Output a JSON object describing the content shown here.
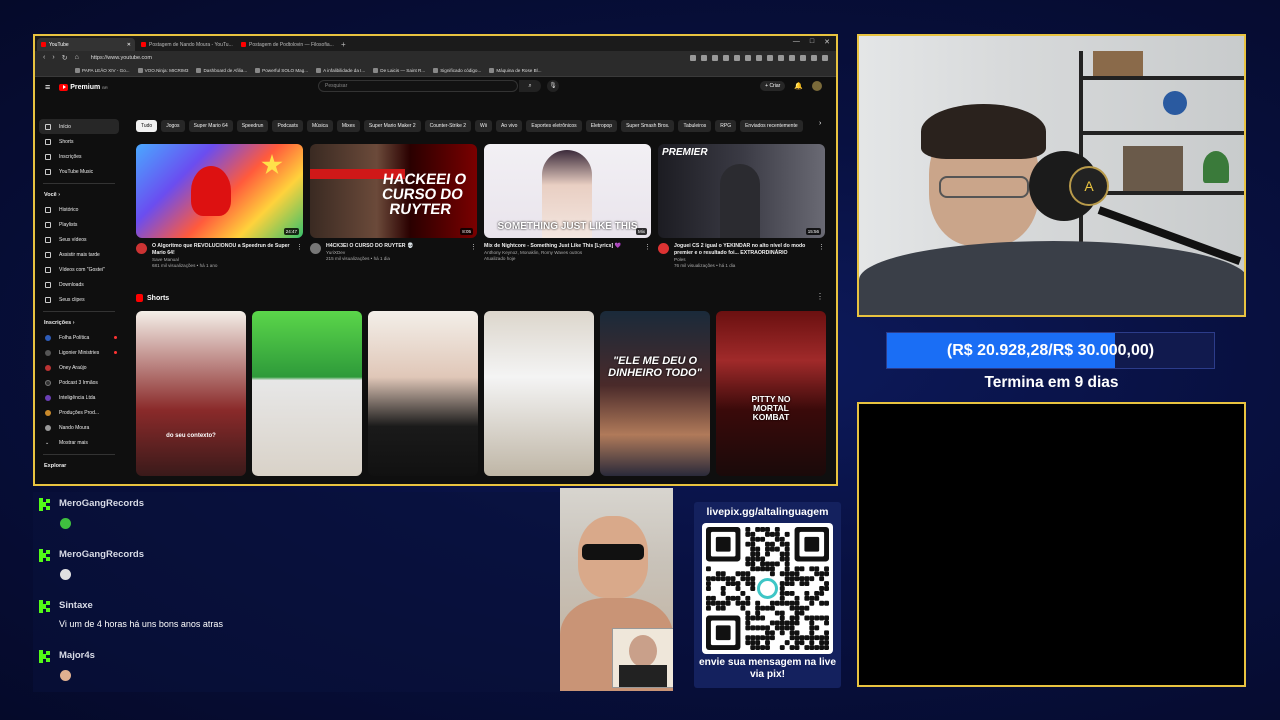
{
  "browser": {
    "tabs": [
      {
        "label": "YouTube",
        "active": true
      },
      {
        "label": "Postagem de Nando Moura - YouTu...",
        "active": false
      },
      {
        "label": "Postagem de Podtolovin — Filosofia...",
        "active": false
      }
    ],
    "new_tab": "+",
    "window_controls": [
      "—",
      "□",
      "✕"
    ],
    "url": "https://www.youtube.com",
    "bookmarks": [
      "PAPA LEÃO XIV - Go...",
      "VOO.Ninja: MICRIM3",
      "Dashboard de Afilia...",
      "Powerful SOLO Mag...",
      "A infalibilidade da I...",
      "De Laicis — Saint R...",
      "Significado código...",
      "Máquina de Rose Bl..."
    ]
  },
  "youtube": {
    "logo": "Premium",
    "logo_sup": "BR",
    "search_placeholder": "Pesquisar",
    "create_label": "Criar",
    "sidebar": {
      "main": [
        {
          "label": "Início",
          "icon": "home-icon",
          "active": true
        },
        {
          "label": "Shorts",
          "icon": "shorts-icon"
        },
        {
          "label": "Inscrições",
          "icon": "subscriptions-icon"
        },
        {
          "label": "YouTube Music",
          "icon": "music-icon"
        }
      ],
      "voce_title": "Você",
      "voce": [
        {
          "label": "Histórico",
          "icon": "history-icon"
        },
        {
          "label": "Playlists",
          "icon": "playlist-icon"
        },
        {
          "label": "Seus vídeos",
          "icon": "your-videos-icon"
        },
        {
          "label": "Assistir mais tarde",
          "icon": "watch-later-icon"
        },
        {
          "label": "Vídeos com \"Gostei\"",
          "icon": "like-icon"
        },
        {
          "label": "Downloads",
          "icon": "download-icon"
        },
        {
          "label": "Seus clipes",
          "icon": "clips-icon"
        }
      ],
      "subs_title": "Inscrições",
      "subs": [
        {
          "label": "Folha Política",
          "color": "#2e5cb8"
        },
        {
          "label": "Ligonier Ministries",
          "color": "#555555"
        },
        {
          "label": "Oney Araújo",
          "color": "#b33"
        },
        {
          "label": "Podcast 3 Irmãos",
          "color": "#333"
        },
        {
          "label": "Inteligência Ltda",
          "color": "#6a3fb5"
        },
        {
          "label": "Produções Prod...",
          "color": "#c98a2b"
        },
        {
          "label": "Nando Moura",
          "color": "#999"
        }
      ],
      "show_more": "Mostrar mais",
      "explore": "Explorar"
    },
    "chips": [
      "Tudo",
      "Jogos",
      "Super Mario 64",
      "Speedrun",
      "Podcasts",
      "Música",
      "Mixes",
      "Super Mario Maker 2",
      "Counter-Strike 2",
      "Wii",
      "Ao vivo",
      "Esportes eletrônicos",
      "Eletropop",
      "Super Smash Bros.",
      "Tabuleiros",
      "RPG",
      "Enviados recentemente"
    ],
    "videos": [
      {
        "title": "O Algoritmo que REVOLUCIONOU a Speedrun de Super Mario 64!",
        "channel": "Save Manual",
        "meta": "681 mil visualizações • há 1 ano",
        "duration": "24:47",
        "thumb_text": ""
      },
      {
        "title": "H4CK3EI O CURSO DO RUYTER 💀",
        "channel": "YuriXDev",
        "meta": "215 mil visualizações • há 1 dia",
        "duration": "8:05",
        "thumb_text": "HACKEEI O CURSO DO RUYTER"
      },
      {
        "title": "Mix de Nightcore - Something Just Like This [Lyrics] 💜",
        "channel": "Anthony Keynoz, Monaklin, Romy Waves outros",
        "meta": "Atualizado hoje",
        "duration": "Mix",
        "thumb_text": "SOMETHING JUST LIKE THIS"
      },
      {
        "title": "Joguei CS 2 igual o YEKINDAR no alto nível do modo premier e o resultado foi... EXTRAORDINÁRIO",
        "channel": "Poles",
        "meta": "76 mil visualizações • há 1 dia",
        "duration": "15:56",
        "thumb_text": "PREMIER"
      }
    ],
    "shorts_title": "Shorts",
    "shorts": [
      {
        "caption": "do seu contexto?"
      },
      {
        "caption": ""
      },
      {
        "caption": ""
      },
      {
        "caption": ""
      },
      {
        "caption": "\"ELE ME DEU O DINHEIRO TODO\""
      },
      {
        "caption": "PITTY NO MORTAL KOMBAT"
      }
    ]
  },
  "chat": [
    {
      "user": "MeroGangRecords",
      "text": "",
      "emote_color": "#3fbf3f"
    },
    {
      "user": "MeroGangRecords",
      "text": "",
      "emote_color": "#e0e0e0"
    },
    {
      "user": "Sintaxe",
      "text": "Vi um de 4 horas há uns bons anos atras",
      "emote_color": ""
    },
    {
      "user": "Major4s",
      "text": "",
      "emote_color": "#e0b090"
    }
  ],
  "qr": {
    "url": "livepix.gg/altalinguagem",
    "caption": "envie sua mensagem na live via pix!"
  },
  "goal": {
    "text": "(R$ 20.928,28/R$ 30.000,00)",
    "progress": 0.6976,
    "subtext": "Termina em 9 dias"
  },
  "colors": {
    "accent_border": "#e8c340",
    "kick_green": "#53fc18",
    "goal_blue": "#1a6ef5",
    "youtube_red": "#ff0000"
  }
}
